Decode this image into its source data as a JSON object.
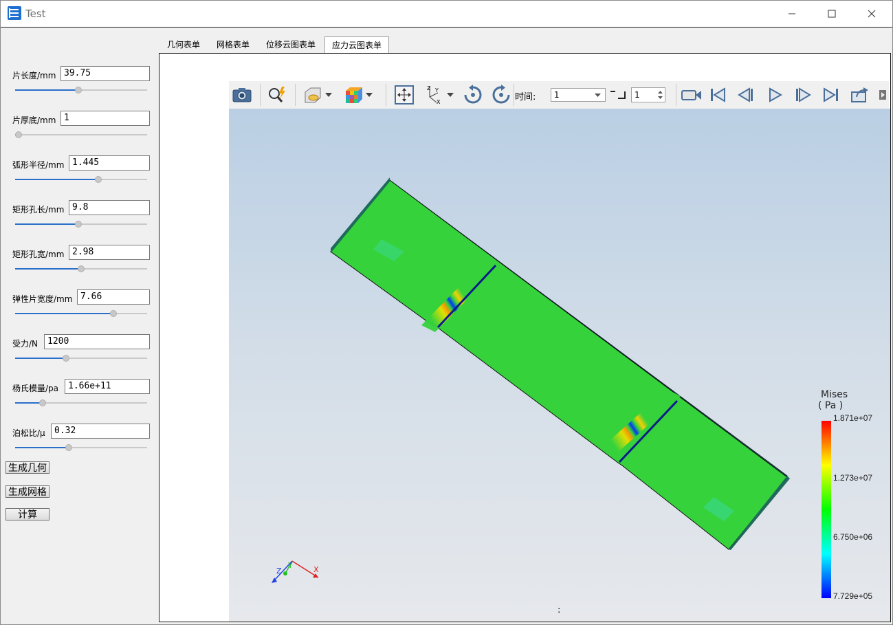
{
  "window": {
    "title": "Test"
  },
  "params": [
    {
      "label": "片长度/mm",
      "value": "39.75",
      "slider": 0.48
    },
    {
      "label": "片厚底/mm",
      "value": "1",
      "slider": 0.0
    },
    {
      "label": "弧形半径/mm",
      "value": "1.445",
      "slider": 0.64
    },
    {
      "label": "矩形孔长/mm",
      "value": "9.8",
      "slider": 0.48
    },
    {
      "label": "矩形孔宽/mm",
      "value": "2.98",
      "slider": 0.5
    },
    {
      "label": "弹性片宽度/mm",
      "value": "7.66",
      "slider": 0.76
    },
    {
      "label": "受力/N",
      "value": "1200",
      "slider": 0.38
    },
    {
      "label": "杨氏模量/pa",
      "value": "1.66e+11",
      "slider": 0.19
    },
    {
      "label": "泊松比/μ",
      "value": "0.32",
      "slider": 0.4
    }
  ],
  "actions": {
    "gen_geometry": "生成几何",
    "gen_mesh": "生成网格",
    "compute": "计算"
  },
  "tabs": [
    "几何表单",
    "网格表单",
    "位移云图表单",
    "应力云图表单"
  ],
  "active_tab": 3,
  "toolbar": {
    "time_label": "时间:",
    "time_value": "1",
    "step_value": "1",
    "icons": [
      "camera-icon",
      "query-icon",
      "clip-icon",
      "color-cube-icon",
      "fit-view-icon",
      "axes-icon",
      "rotate-left-icon",
      "rotate-right-icon",
      "record-icon",
      "first-frame-icon",
      "prev-frame-icon",
      "play-icon",
      "next-frame-icon",
      "last-frame-icon",
      "export-icon"
    ]
  },
  "legend": {
    "title": "Mises",
    "unit": "( Pa )",
    "max": "1.871e+07",
    "t2": "1.273e+07",
    "t3": "6.750e+06",
    "min": "7.729e+05"
  },
  "viewport_status": ":",
  "axes_labels": {
    "x": "X",
    "y": "Y",
    "z": "Z"
  },
  "colors": {
    "accent": "#2a6fc9",
    "mesh_green": "#35d23c"
  }
}
